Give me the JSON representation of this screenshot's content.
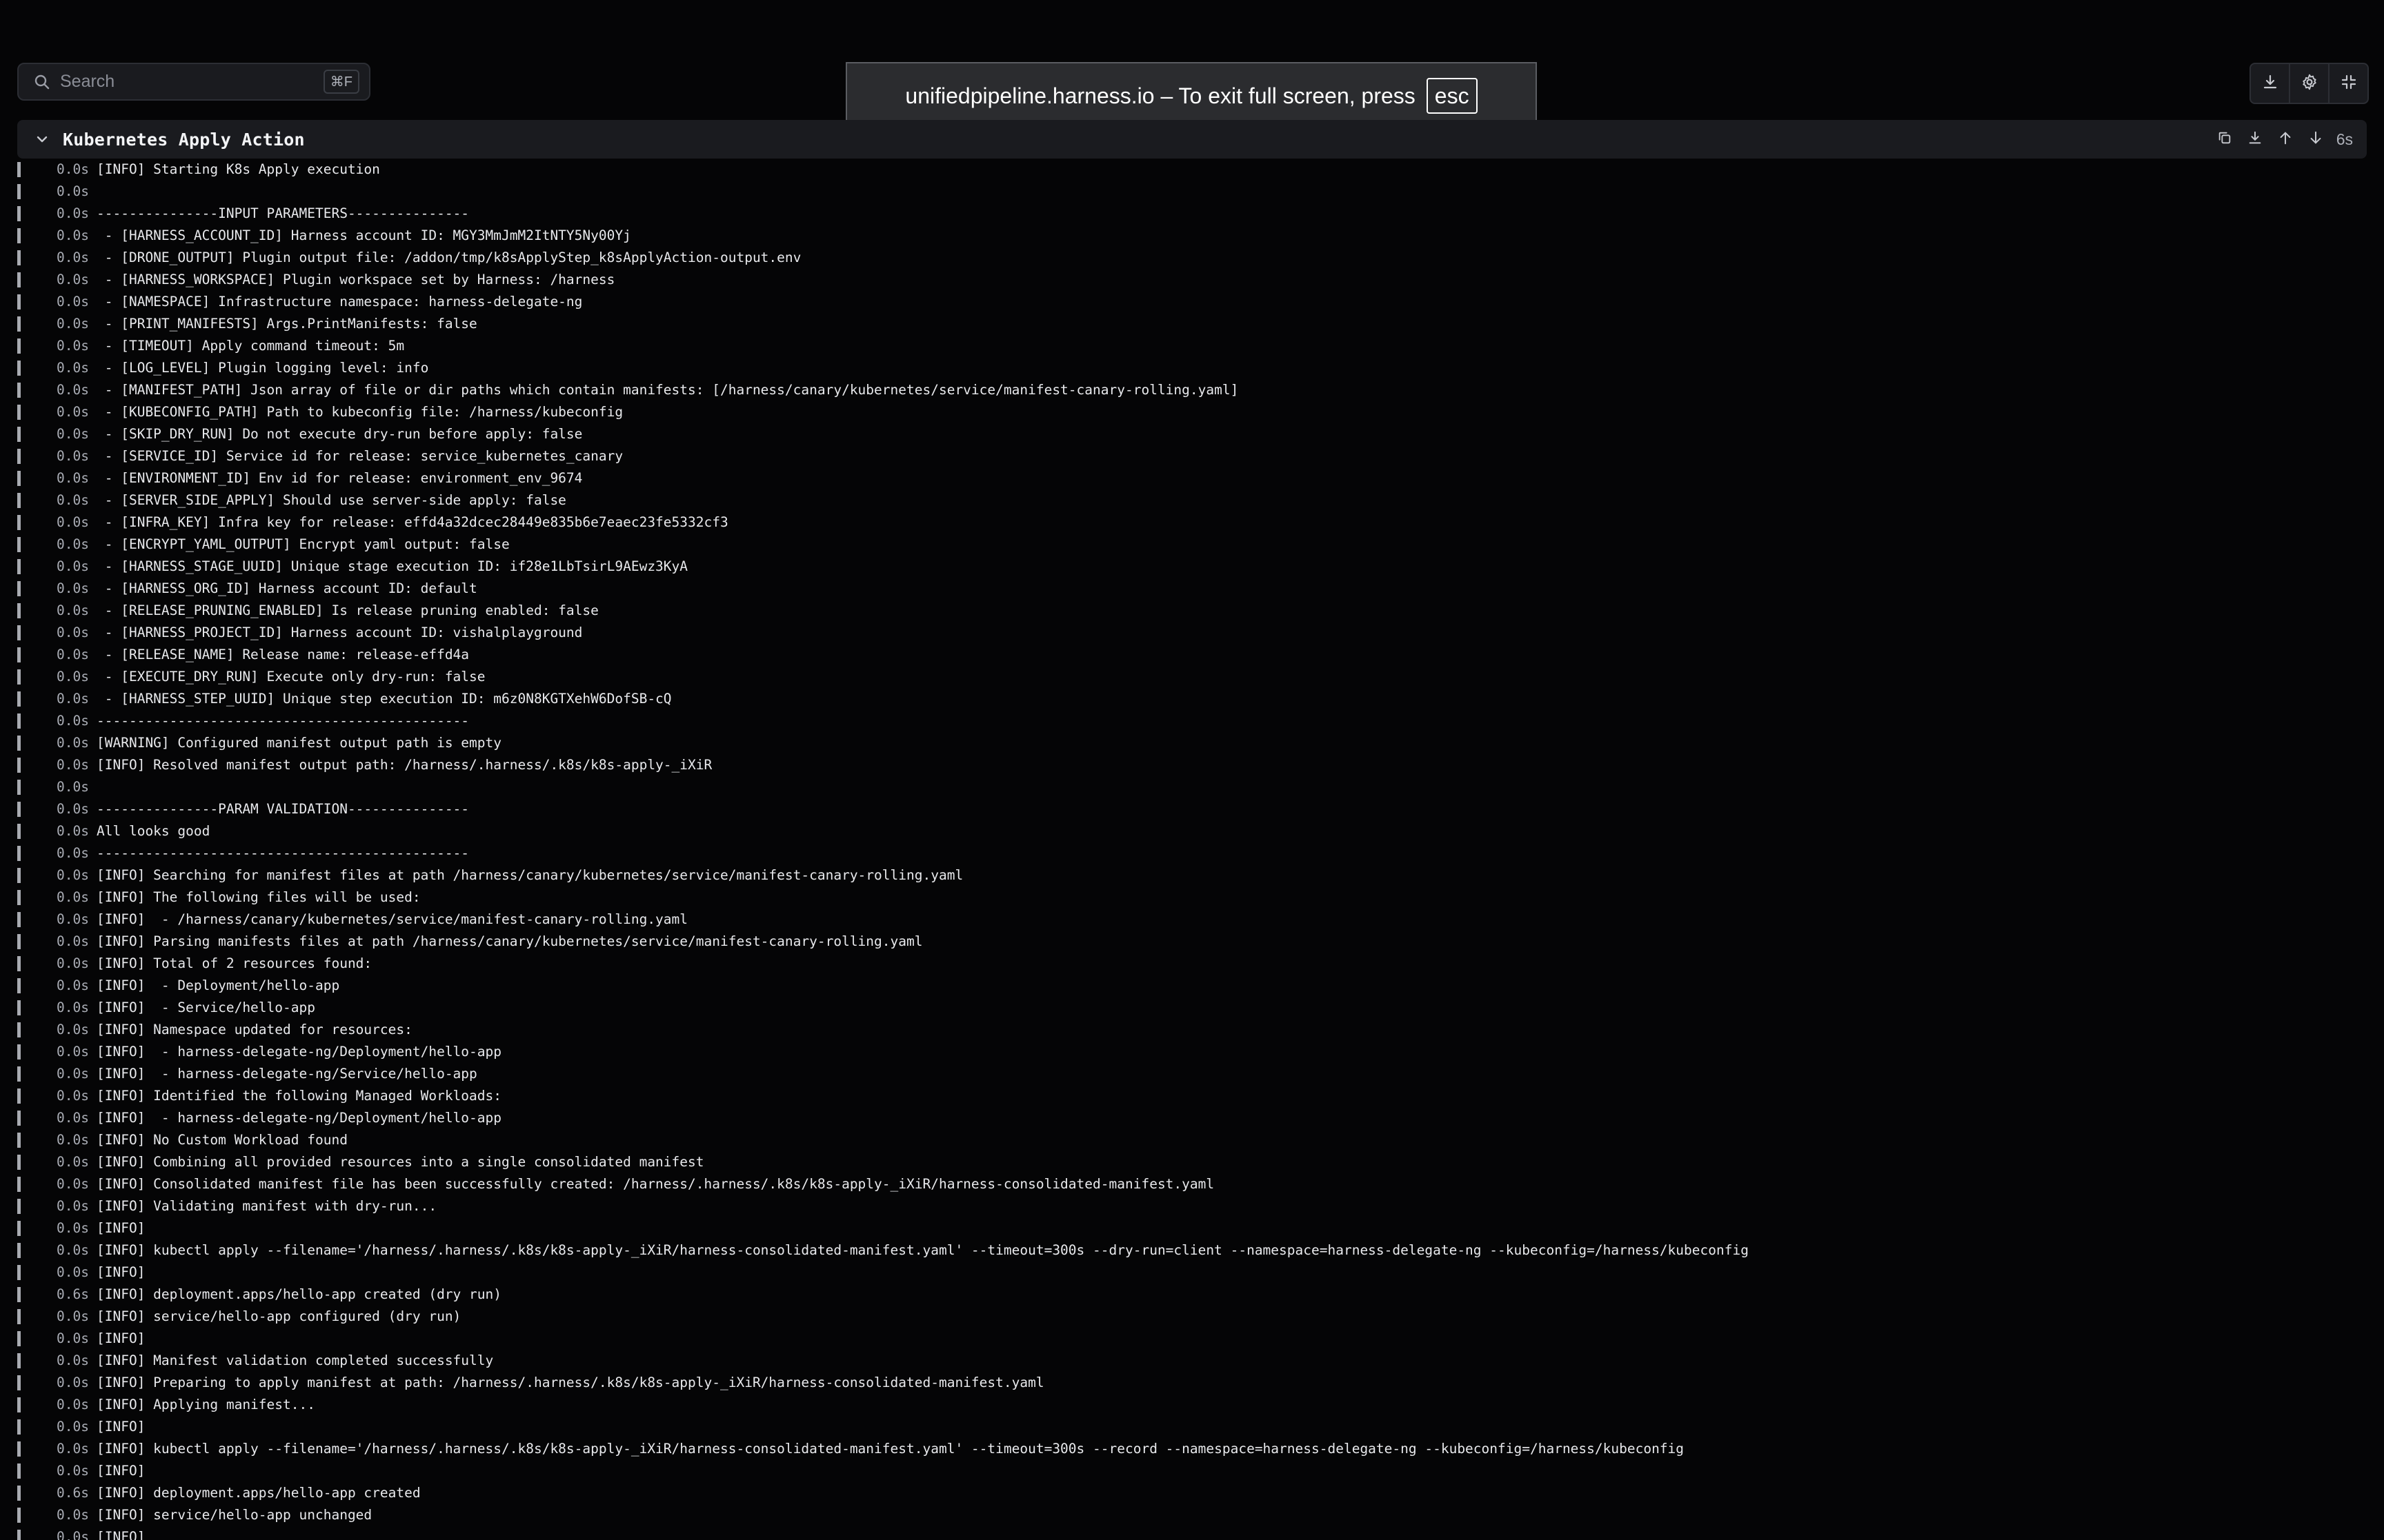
{
  "search": {
    "placeholder": "Search",
    "shortcut": "⌘F"
  },
  "fullscreen_notice": {
    "text": "unifiedpipeline.harness.io – To exit full screen, press",
    "key": "esc"
  },
  "toolbar": {
    "buttons": [
      {
        "icon": "download-icon"
      },
      {
        "icon": "gear-icon"
      },
      {
        "icon": "exit-fullscreen-icon"
      }
    ]
  },
  "section": {
    "title": "Kubernetes Apply Action",
    "duration": "6s",
    "actions": [
      "copy-icon",
      "download-icon",
      "arrow-up-icon",
      "arrow-down-icon"
    ]
  },
  "log_lines": [
    {
      "ts": "0.0s",
      "msg": "[INFO] Starting K8s Apply execution"
    },
    {
      "ts": "0.0s",
      "msg": ""
    },
    {
      "ts": "0.0s",
      "msg": "---------------INPUT PARAMETERS---------------"
    },
    {
      "ts": "0.0s",
      "msg": " - [HARNESS_ACCOUNT_ID] Harness account ID: MGY3MmJmM2ItNTY5Ny00Yj"
    },
    {
      "ts": "0.0s",
      "msg": " - [DRONE_OUTPUT] Plugin output file: /addon/tmp/k8sApplyStep_k8sApplyAction-output.env"
    },
    {
      "ts": "0.0s",
      "msg": " - [HARNESS_WORKSPACE] Plugin workspace set by Harness: /harness"
    },
    {
      "ts": "0.0s",
      "msg": " - [NAMESPACE] Infrastructure namespace: harness-delegate-ng"
    },
    {
      "ts": "0.0s",
      "msg": " - [PRINT_MANIFESTS] Args.PrintManifests: false"
    },
    {
      "ts": "0.0s",
      "msg": " - [TIMEOUT] Apply command timeout: 5m"
    },
    {
      "ts": "0.0s",
      "msg": " - [LOG_LEVEL] Plugin logging level: info"
    },
    {
      "ts": "0.0s",
      "msg": " - [MANIFEST_PATH] Json array of file or dir paths which contain manifests: [/harness/canary/kubernetes/service/manifest-canary-rolling.yaml]"
    },
    {
      "ts": "0.0s",
      "msg": " - [KUBECONFIG_PATH] Path to kubeconfig file: /harness/kubeconfig"
    },
    {
      "ts": "0.0s",
      "msg": " - [SKIP_DRY_RUN] Do not execute dry-run before apply: false"
    },
    {
      "ts": "0.0s",
      "msg": " - [SERVICE_ID] Service id for release: service_kubernetes_canary"
    },
    {
      "ts": "0.0s",
      "msg": " - [ENVIRONMENT_ID] Env id for release: environment_env_9674"
    },
    {
      "ts": "0.0s",
      "msg": " - [SERVER_SIDE_APPLY] Should use server-side apply: false"
    },
    {
      "ts": "0.0s",
      "msg": " - [INFRA_KEY] Infra key for release: effd4a32dcec28449e835b6e7eaec23fe5332cf3"
    },
    {
      "ts": "0.0s",
      "msg": " - [ENCRYPT_YAML_OUTPUT] Encrypt yaml output: false"
    },
    {
      "ts": "0.0s",
      "msg": " - [HARNESS_STAGE_UUID] Unique stage execution ID: if28e1LbTsirL9AEwz3KyA"
    },
    {
      "ts": "0.0s",
      "msg": " - [HARNESS_ORG_ID] Harness account ID: default"
    },
    {
      "ts": "0.0s",
      "msg": " - [RELEASE_PRUNING_ENABLED] Is release pruning enabled: false"
    },
    {
      "ts": "0.0s",
      "msg": " - [HARNESS_PROJECT_ID] Harness account ID: vishalplayground"
    },
    {
      "ts": "0.0s",
      "msg": " - [RELEASE_NAME] Release name: release-effd4a"
    },
    {
      "ts": "0.0s",
      "msg": " - [EXECUTE_DRY_RUN] Execute only dry-run: false"
    },
    {
      "ts": "0.0s",
      "msg": " - [HARNESS_STEP_UUID] Unique step execution ID: m6z0N8KGTXehW6DofSB-cQ"
    },
    {
      "ts": "0.0s",
      "msg": "----------------------------------------------"
    },
    {
      "ts": "0.0s",
      "msg": "[WARNING] Configured manifest output path is empty"
    },
    {
      "ts": "0.0s",
      "msg": "[INFO] Resolved manifest output path: /harness/.harness/.k8s/k8s-apply-_iXiR"
    },
    {
      "ts": "0.0s",
      "msg": ""
    },
    {
      "ts": "0.0s",
      "msg": "---------------PARAM VALIDATION---------------"
    },
    {
      "ts": "0.0s",
      "msg": "All looks good"
    },
    {
      "ts": "0.0s",
      "msg": "----------------------------------------------"
    },
    {
      "ts": "0.0s",
      "msg": "[INFO] Searching for manifest files at path /harness/canary/kubernetes/service/manifest-canary-rolling.yaml"
    },
    {
      "ts": "0.0s",
      "msg": "[INFO] The following files will be used:"
    },
    {
      "ts": "0.0s",
      "msg": "[INFO]  - /harness/canary/kubernetes/service/manifest-canary-rolling.yaml"
    },
    {
      "ts": "0.0s",
      "msg": "[INFO] Parsing manifests files at path /harness/canary/kubernetes/service/manifest-canary-rolling.yaml"
    },
    {
      "ts": "0.0s",
      "msg": "[INFO] Total of 2 resources found:"
    },
    {
      "ts": "0.0s",
      "msg": "[INFO]  - Deployment/hello-app"
    },
    {
      "ts": "0.0s",
      "msg": "[INFO]  - Service/hello-app"
    },
    {
      "ts": "0.0s",
      "msg": "[INFO] Namespace updated for resources:"
    },
    {
      "ts": "0.0s",
      "msg": "[INFO]  - harness-delegate-ng/Deployment/hello-app"
    },
    {
      "ts": "0.0s",
      "msg": "[INFO]  - harness-delegate-ng/Service/hello-app"
    },
    {
      "ts": "0.0s",
      "msg": "[INFO] Identified the following Managed Workloads:"
    },
    {
      "ts": "0.0s",
      "msg": "[INFO]  - harness-delegate-ng/Deployment/hello-app"
    },
    {
      "ts": "0.0s",
      "msg": "[INFO] No Custom Workload found"
    },
    {
      "ts": "0.0s",
      "msg": "[INFO] Combining all provided resources into a single consolidated manifest"
    },
    {
      "ts": "0.0s",
      "msg": "[INFO] Consolidated manifest file has been successfully created: /harness/.harness/.k8s/k8s-apply-_iXiR/harness-consolidated-manifest.yaml"
    },
    {
      "ts": "0.0s",
      "msg": "[INFO] Validating manifest with dry-run..."
    },
    {
      "ts": "0.0s",
      "msg": "[INFO]"
    },
    {
      "ts": "0.0s",
      "msg": "[INFO] kubectl apply --filename='/harness/.harness/.k8s/k8s-apply-_iXiR/harness-consolidated-manifest.yaml' --timeout=300s --dry-run=client --namespace=harness-delegate-ng --kubeconfig=/harness/kubeconfig"
    },
    {
      "ts": "0.0s",
      "msg": "[INFO]"
    },
    {
      "ts": "0.6s",
      "msg": "[INFO] deployment.apps/hello-app created (dry run)"
    },
    {
      "ts": "0.0s",
      "msg": "[INFO] service/hello-app configured (dry run)"
    },
    {
      "ts": "0.0s",
      "msg": "[INFO]"
    },
    {
      "ts": "0.0s",
      "msg": "[INFO] Manifest validation completed successfully"
    },
    {
      "ts": "0.0s",
      "msg": "[INFO] Preparing to apply manifest at path: /harness/.harness/.k8s/k8s-apply-_iXiR/harness-consolidated-manifest.yaml"
    },
    {
      "ts": "0.0s",
      "msg": "[INFO] Applying manifest..."
    },
    {
      "ts": "0.0s",
      "msg": "[INFO]"
    },
    {
      "ts": "0.0s",
      "msg": "[INFO] kubectl apply --filename='/harness/.harness/.k8s/k8s-apply-_iXiR/harness-consolidated-manifest.yaml' --timeout=300s --record --namespace=harness-delegate-ng --kubeconfig=/harness/kubeconfig"
    },
    {
      "ts": "0.0s",
      "msg": "[INFO]"
    },
    {
      "ts": "0.6s",
      "msg": "[INFO] deployment.apps/hello-app created"
    },
    {
      "ts": "0.0s",
      "msg": "[INFO] service/hello-app unchanged"
    },
    {
      "ts": "0.0s",
      "msg": "[INFO]"
    }
  ]
}
